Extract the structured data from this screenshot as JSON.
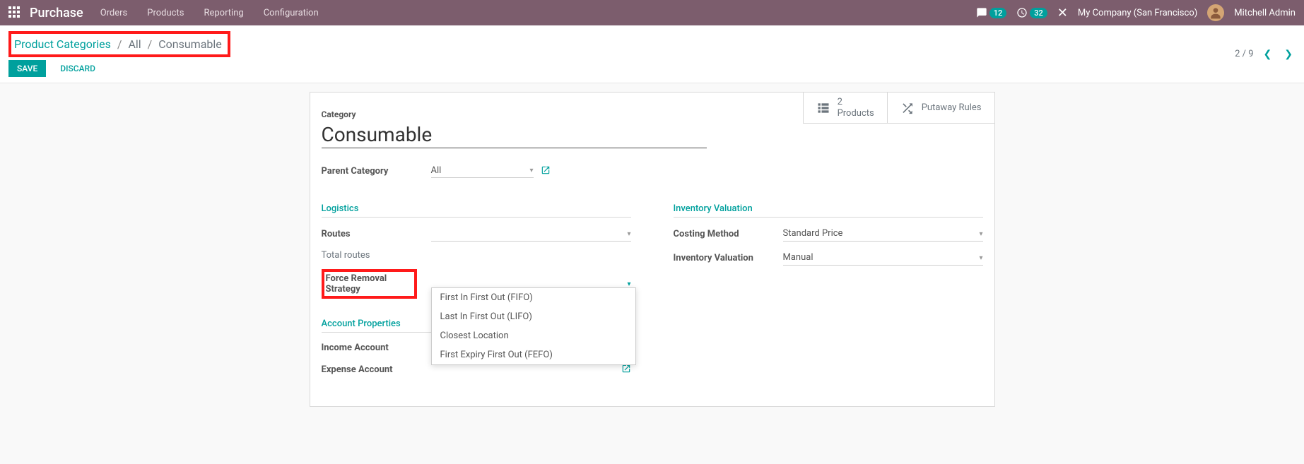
{
  "topbar": {
    "brand": "Purchase",
    "nav": [
      "Orders",
      "Products",
      "Reporting",
      "Configuration"
    ],
    "chat_count": "12",
    "activity_count": "32",
    "company": "My Company (San Francisco)",
    "user": "Mitchell Admin"
  },
  "breadcrumb": {
    "root": "Product Categories",
    "path": "All",
    "current": "Consumable"
  },
  "actions": {
    "save": "SAVE",
    "discard": "DISCARD"
  },
  "pager": {
    "position": "2 / 9"
  },
  "stat": {
    "products_count": "2",
    "products_label": "Products",
    "putaway_label": "Putaway Rules"
  },
  "form": {
    "category_label": "Category",
    "category_value": "Consumable",
    "parent_category_label": "Parent Category",
    "parent_category_value": "All"
  },
  "logistics": {
    "title": "Logistics",
    "routes_label": "Routes",
    "total_routes_label": "Total routes",
    "force_removal_label": "Force Removal Strategy",
    "dropdown_options": [
      "First In First Out (FIFO)",
      "Last In First Out (LIFO)",
      "Closest Location",
      "First Expiry First Out (FEFO)"
    ]
  },
  "inventory": {
    "title": "Inventory Valuation",
    "costing_method_label": "Costing Method",
    "costing_method_value": "Standard Price",
    "inventory_valuation_label": "Inventory Valuation",
    "inventory_valuation_value": "Manual"
  },
  "accounts": {
    "title": "Account Properties",
    "income_label": "Income Account",
    "expense_label": "Expense Account"
  }
}
